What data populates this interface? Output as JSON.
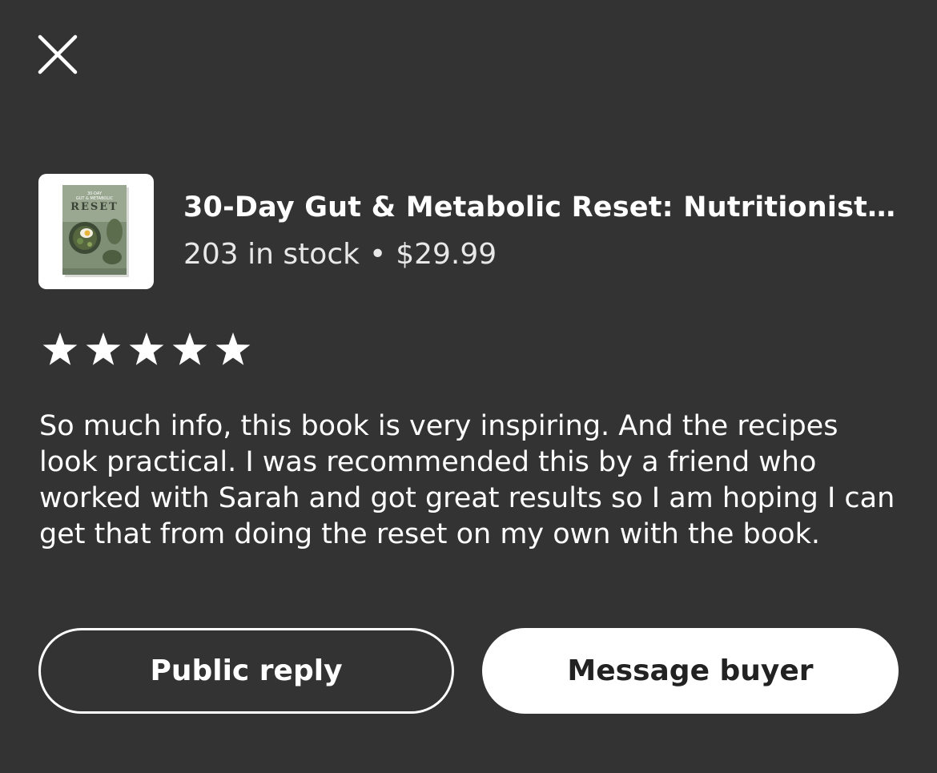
{
  "icons": {
    "close": "close-icon",
    "star": "star-icon"
  },
  "product": {
    "title": "30-Day Gut & Metabolic Reset: Nutritionist H...",
    "stock": "203 in stock",
    "separator": "•",
    "price": "$29.99",
    "thumbnail_cover_text": "RESET"
  },
  "review": {
    "rating": 5,
    "max_rating": 5,
    "text": "So much info, this book is very inspiring. And the recipes look practical. I was recommended this by a friend who worked with Sarah and got great results so I am hoping I can get that from doing the reset on my own with the book."
  },
  "actions": {
    "public_reply_label": "Public reply",
    "message_buyer_label": "Message buyer"
  },
  "colors": {
    "background": "#333333",
    "text": "#ffffff",
    "star": "#ffffff"
  }
}
